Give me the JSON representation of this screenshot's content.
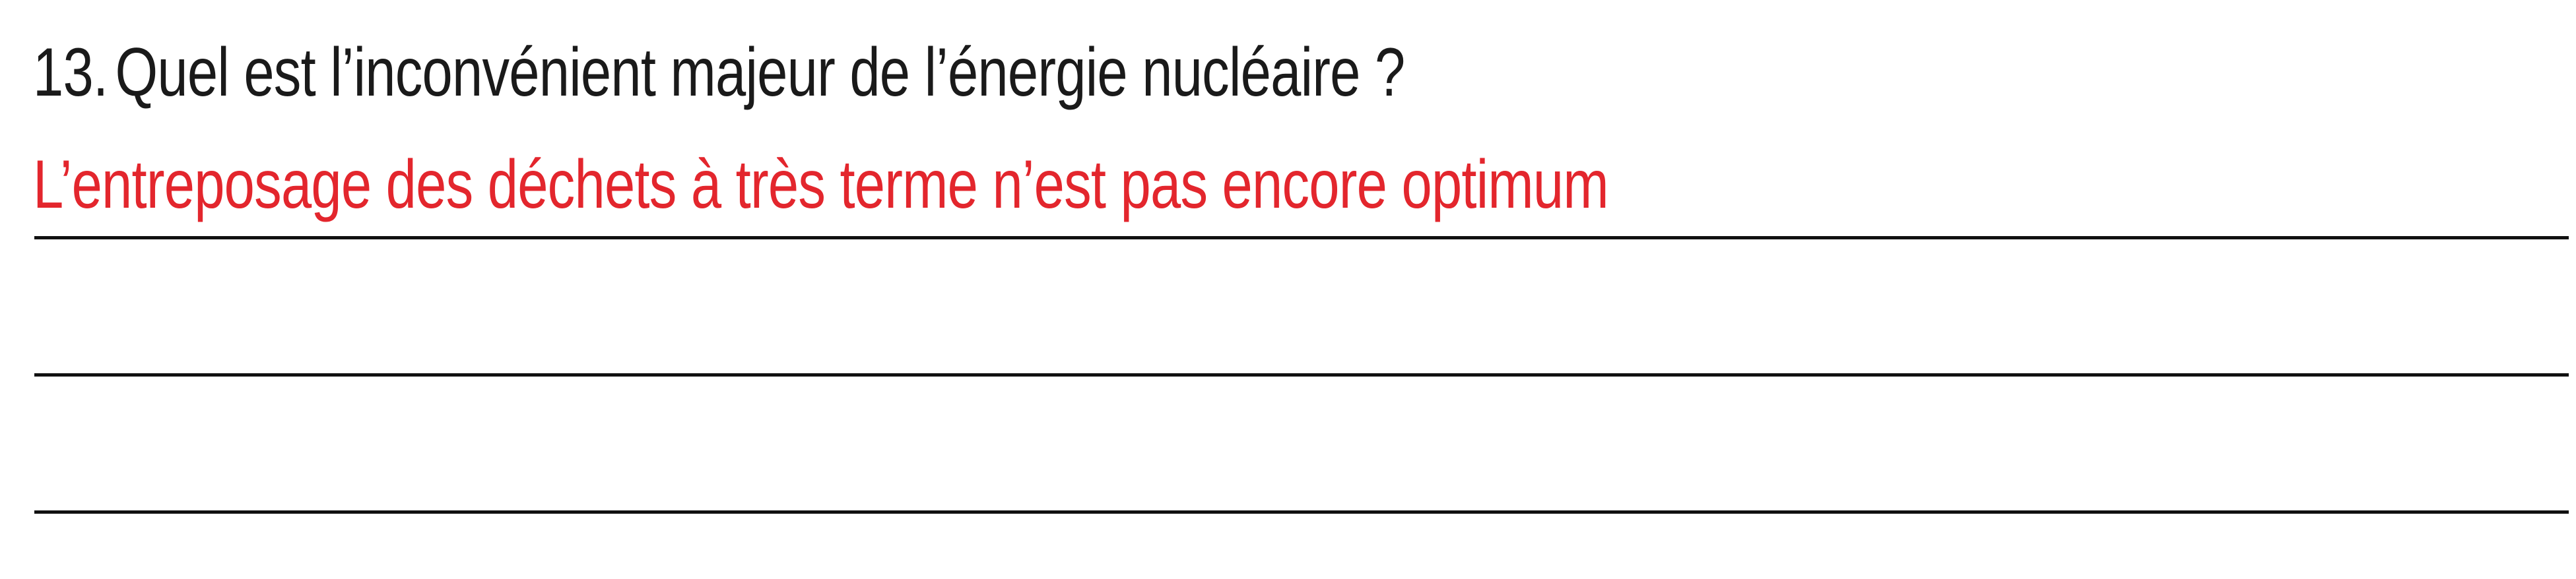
{
  "worksheet": {
    "question": {
      "number": "13.",
      "text": "Quel est l’inconvénient majeur de l’énergie nucléaire ?"
    },
    "answer": {
      "text": "L’entreposage des déchets à très terme n’est pas encore optimum",
      "color": "#e3262d"
    },
    "answer_line_count": 3
  }
}
